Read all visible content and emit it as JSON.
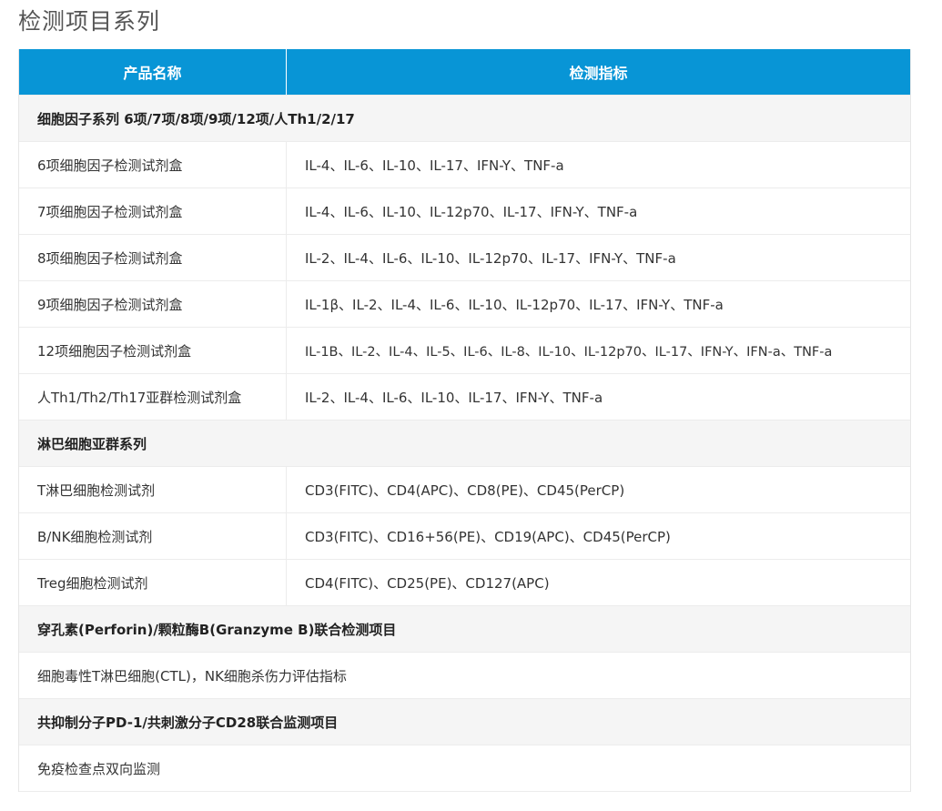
{
  "page": {
    "title": "检测项目系列"
  },
  "table": {
    "headers": {
      "product": "产品名称",
      "indicator": "检测指标"
    },
    "groups": [
      {
        "title": "细胞因子系列 6项/7项/8项/9项/12项/人Th1/2/17",
        "rows": [
          {
            "product": "6项细胞因子检测试剂盒",
            "indicator": "IL-4、IL-6、IL-10、IL-17、IFN-Y、TNF-a"
          },
          {
            "product": "7项细胞因子检测试剂盒",
            "indicator": "IL-4、IL-6、IL-10、IL-12p70、IL-17、IFN-Y、TNF-a"
          },
          {
            "product": "8项细胞因子检测试剂盒",
            "indicator": "IL-2、IL-4、IL-6、IL-10、IL-12p70、IL-17、IFN-Y、TNF-a"
          },
          {
            "product": "9项细胞因子检测试剂盒",
            "indicator": "IL-1β、IL-2、IL-4、IL-6、IL-10、IL-12p70、IL-17、IFN-Y、TNF-a"
          },
          {
            "product": "12项细胞因子检测试剂盒",
            "indicator": "IL-1B、IL-2、IL-4、IL-5、IL-6、IL-8、IL-10、IL-12p70、IL-17、IFN-Y、IFN-a、TNF-a"
          },
          {
            "product": "人Th1/Th2/Th17亚群检测试剂盒",
            "indicator": "IL-2、IL-4、IL-6、IL-10、IL-17、IFN-Y、TNF-a"
          }
        ]
      },
      {
        "title": "淋巴细胞亚群系列",
        "rows": [
          {
            "product": "T淋巴细胞检测试剂",
            "indicator": "CD3(FITC)、CD4(APC)、CD8(PE)、CD45(PerCP)"
          },
          {
            "product": "B/NK细胞检测试剂",
            "indicator": "CD3(FITC)、CD16+56(PE)、CD19(APC)、CD45(PerCP)"
          },
          {
            "product": "Treg细胞检测试剂",
            "indicator": "CD4(FITC)、CD25(PE)、CD127(APC)"
          }
        ]
      },
      {
        "title": "穿孔素(Perforin)/颗粒酶B(Granzyme B)联合检测项目",
        "note": "细胞毒性T淋巴细胞(CTL)，NK细胞杀伤力评估指标"
      },
      {
        "title": "共抑制分子PD-1/共刺激分子CD28联合监测项目",
        "note": "免疫检查点双向监测"
      }
    ]
  }
}
